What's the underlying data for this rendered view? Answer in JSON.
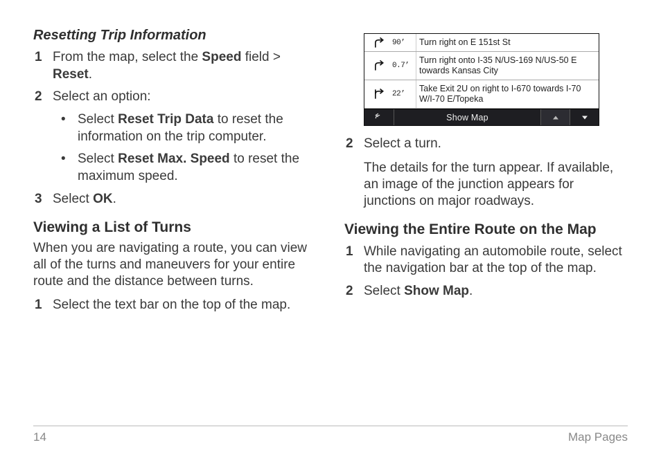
{
  "left": {
    "heading_reset": "Resetting Trip Information",
    "step1_prefix": "From the map, select the ",
    "step1_bold1": "Speed",
    "step1_mid": " field > ",
    "step1_bold2": "Reset",
    "step1_suffix": ".",
    "step2": "Select an option:",
    "bullet1_prefix": "Select ",
    "bullet1_bold": "Reset Trip Data",
    "bullet1_suffix": " to reset the information on the trip computer.",
    "bullet2_prefix": "Select ",
    "bullet2_bold": "Reset Max. Speed",
    "bullet2_suffix": " to reset the maximum speed.",
    "step3_prefix": "Select ",
    "step3_bold": "OK",
    "step3_suffix": ".",
    "heading_turns": "Viewing a List of Turns",
    "turns_intro": "When you are navigating a route, you can view all of the turns and maneuvers for your entire route and the distance between turns.",
    "turns_step1": "Select the text bar on the top of the map."
  },
  "device": {
    "rows": [
      {
        "dist": "90’",
        "text": "Turn right on E 151st St"
      },
      {
        "dist": "0.7’",
        "text": "Turn right onto I-35 N/US-169 N/US-50 E towards Kansas City"
      },
      {
        "dist": "22’",
        "text": "Take Exit 2U on right to I-670 towards I-70 W/I-70 E/Topeka"
      }
    ],
    "bar_label": "Show Map"
  },
  "right": {
    "step2": "Select a turn.",
    "step2_detail": "The details for the turn appear. If available, an image of the junction appears for junctions on major roadways.",
    "heading_route": "Viewing the Entire Route on the Map",
    "route_step1": "While navigating an automobile route, select the navigation bar at the top of the map.",
    "route_step2_prefix": "Select ",
    "route_step2_bold": "Show Map",
    "route_step2_suffix": "."
  },
  "footer": {
    "page": "14",
    "section": "Map Pages"
  },
  "nums": {
    "n1": "1",
    "n2": "2",
    "n3": "3"
  }
}
